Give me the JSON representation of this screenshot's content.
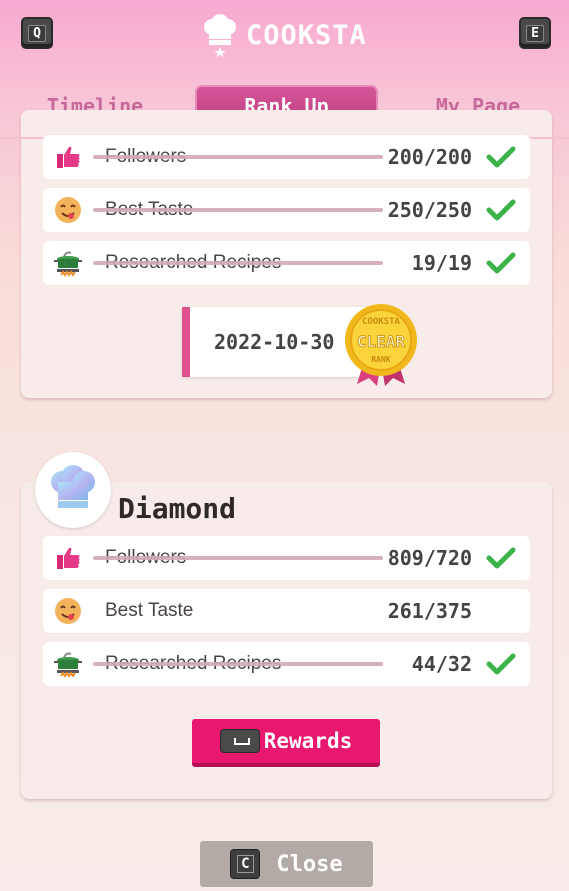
{
  "header": {
    "app_title": "COOKSTA",
    "left_key": "Q",
    "right_key": "E"
  },
  "tabs": [
    {
      "label": "Timeline",
      "active": false
    },
    {
      "label": "Rank Up",
      "active": true
    },
    {
      "label": "My Page",
      "active": false
    }
  ],
  "completed_rank": {
    "requirements": [
      {
        "label": "Followers",
        "value": "200/200",
        "icon": "thumbs-up-icon",
        "met": true
      },
      {
        "label": "Best Taste",
        "value": "250/250",
        "icon": "tasty-face-icon",
        "met": true
      },
      {
        "label": "Researched Recipes",
        "value": "19/19",
        "icon": "cooking-pot-icon",
        "met": true
      }
    ],
    "clear_date": "2022-10-30",
    "medal": {
      "top_text": "COOKSTA",
      "center_text": "CLEAR",
      "bottom_text": "RANK"
    }
  },
  "next_rank": {
    "name": "Diamond",
    "avatar_icon": "diamond-chef-hat-icon",
    "requirements": [
      {
        "label": "Followers",
        "value": "809/720",
        "icon": "thumbs-up-icon",
        "met": true
      },
      {
        "label": "Best Taste",
        "value": "261/375",
        "icon": "tasty-face-icon",
        "met": false
      },
      {
        "label": "Researched Recipes",
        "value": "44/32",
        "icon": "cooking-pot-icon",
        "met": true
      }
    ],
    "rewards_label": "Rewards"
  },
  "footer": {
    "close_key": "C",
    "close_label": "Close"
  },
  "colors": {
    "accent": "#e8186f",
    "tab_active": "#c8488a",
    "check": "#3cb34a"
  }
}
